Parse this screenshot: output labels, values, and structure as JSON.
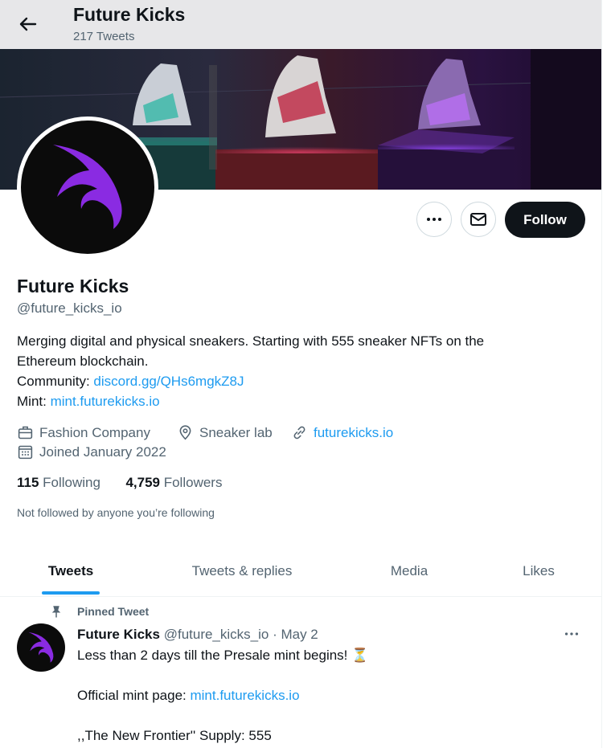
{
  "header": {
    "title": "Future Kicks",
    "tweet_count": "217 Tweets"
  },
  "profile": {
    "name": "Future Kicks",
    "handle": "@future_kicks_io",
    "follow_label": "Follow",
    "bio": {
      "line1": "Merging digital and physical sneakers. Starting with 555 sneaker NFTs on the",
      "line2": "Ethereum blockchain.",
      "community_label": "Community: ",
      "community_link": "discord.gg/QHs6mgkZ8J",
      "mint_label": "Mint: ",
      "mint_link": "mint.futurekicks.io"
    },
    "category": "Fashion Company",
    "location": "Sneaker lab",
    "website": "futurekicks.io",
    "joined": "Joined January 2022",
    "following_count": "115",
    "following_label": " Following",
    "followers_count": "4,759",
    "followers_label": " Followers",
    "not_followed": "Not followed by anyone you’re following"
  },
  "tabs": [
    {
      "label": "Tweets",
      "active": true
    },
    {
      "label": "Tweets & replies",
      "active": false
    },
    {
      "label": "Media",
      "active": false
    },
    {
      "label": "Likes",
      "active": false
    }
  ],
  "pinned_tweet": {
    "pinned_label": "Pinned Tweet",
    "author_name": "Future Kicks",
    "author_handle": " @future_kicks_io",
    "date": " · May 2",
    "line1": "Less than 2 days till the Presale mint begins! ⏳",
    "line2_label": "Official mint page: ",
    "line2_link": "mint.futurekicks.io",
    "line3": ",,The New Frontier'' Supply: 555"
  },
  "icons": {
    "back": "arrow-left-icon",
    "more": "more-icon",
    "message": "envelope-icon",
    "category": "briefcase-icon",
    "location": "location-pin-icon",
    "website": "link-icon",
    "joined": "calendar-icon",
    "pin": "pin-icon"
  },
  "colors": {
    "accent": "#1d9bf0",
    "logo_purple": "#8a2be2",
    "follow_button": "#0f1419"
  }
}
